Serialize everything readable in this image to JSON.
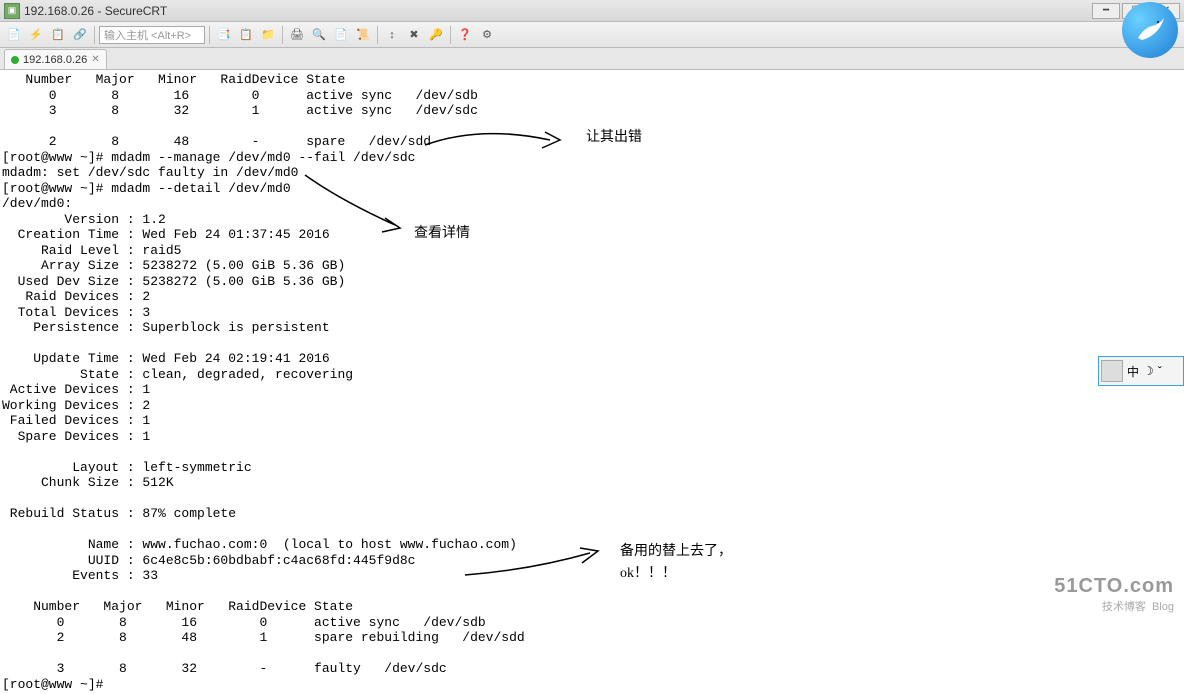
{
  "window": {
    "title": "192.168.0.26 - SecureCRT",
    "min": "━",
    "max": "☐",
    "close": "✕"
  },
  "toolbar": {
    "host_placeholder": "输入主机 <Alt+R>"
  },
  "tab": {
    "label": "192.168.0.26",
    "close": "✕"
  },
  "term": {
    "l1": "   Number   Major   Minor   RaidDevice State",
    "l2": "      0       8       16        0      active sync   /dev/sdb",
    "l3": "      3       8       32        1      active sync   /dev/sdc",
    "l4": "",
    "l5": "      2       8       48        -      spare   /dev/sdd",
    "l6": "[root@www ~]# mdadm --manage /dev/md0 --fail /dev/sdc",
    "l7": "mdadm: set /dev/sdc faulty in /dev/md0",
    "l8": "[root@www ~]# mdadm --detail /dev/md0",
    "l9": "/dev/md0:",
    "l10": "        Version : 1.2",
    "l11": "  Creation Time : Wed Feb 24 01:37:45 2016",
    "l12": "     Raid Level : raid5",
    "l13": "     Array Size : 5238272 (5.00 GiB 5.36 GB)",
    "l14": "  Used Dev Size : 5238272 (5.00 GiB 5.36 GB)",
    "l15": "   Raid Devices : 2",
    "l16": "  Total Devices : 3",
    "l17": "    Persistence : Superblock is persistent",
    "l18": "",
    "l19": "    Update Time : Wed Feb 24 02:19:41 2016",
    "l20": "          State : clean, degraded, recovering",
    "l21": " Active Devices : 1",
    "l22": "Working Devices : 2",
    "l23": " Failed Devices : 1",
    "l24": "  Spare Devices : 1",
    "l25": "",
    "l26": "         Layout : left-symmetric",
    "l27": "     Chunk Size : 512K",
    "l28": "",
    "l29": " Rebuild Status : 87% complete",
    "l30": "",
    "l31": "           Name : www.fuchao.com:0  (local to host www.fuchao.com)",
    "l32": "           UUID : 6c4e8c5b:60bdbabf:c4ac68fd:445f9d8c",
    "l33": "         Events : 33",
    "l34": "",
    "l35": "    Number   Major   Minor   RaidDevice State",
    "l36": "       0       8       16        0      active sync   /dev/sdb",
    "l37": "       2       8       48        1      spare rebuilding   /dev/sdd",
    "l38": "",
    "l39": "       3       8       32        -      faulty   /dev/sdc",
    "l40": "[root@www ~]#"
  },
  "annotations": {
    "a1": "让其出错",
    "a2": "查看详情",
    "a3": "备用的替上去了，",
    "a4": "ok！！！"
  },
  "ime": {
    "lang": "中",
    "moon": "☽",
    "dots": "ˇ"
  },
  "watermark": {
    "line1": "51CTO.com",
    "line2": "技术博客",
    "line3": "Blog"
  }
}
